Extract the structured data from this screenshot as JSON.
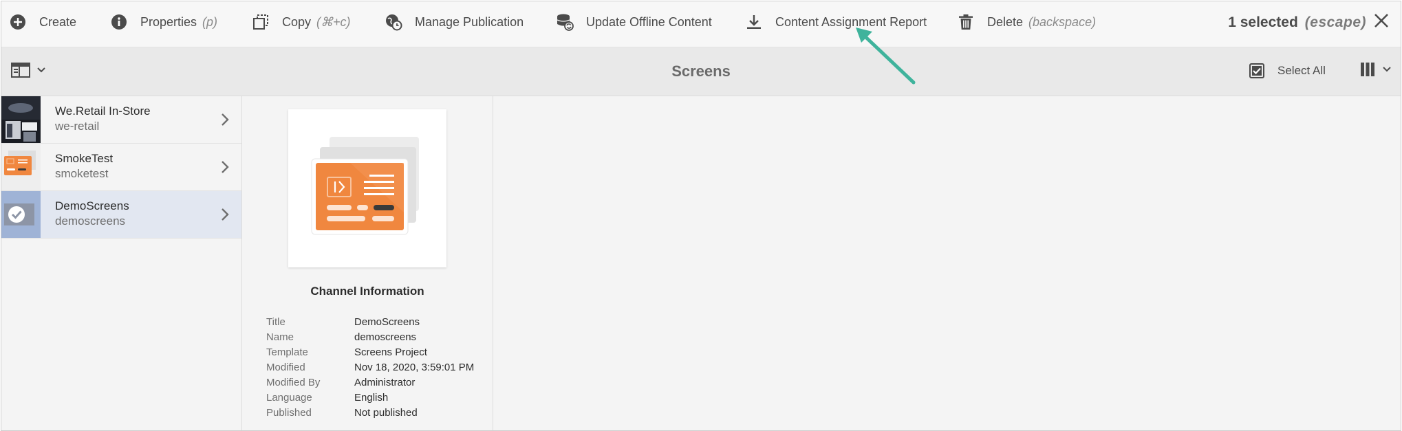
{
  "actionbar": {
    "items": [
      {
        "label": "Create",
        "icon": "plus-circle-icon"
      },
      {
        "label": "Properties",
        "shortcut": "(p)",
        "icon": "info-circle-icon"
      },
      {
        "label": "Copy",
        "shortcut": "(⌘+c)",
        "icon": "copy-icon"
      },
      {
        "label": "Manage Publication",
        "icon": "globe-clock-icon"
      },
      {
        "label": "Update Offline Content",
        "icon": "database-sync-icon"
      },
      {
        "label": "Content Assignment Report",
        "icon": "download-icon"
      },
      {
        "label": "Delete",
        "shortcut": "(backspace)",
        "icon": "trash-icon"
      }
    ],
    "selection": {
      "count_label": "1 selected",
      "escape_hint": "(escape)"
    }
  },
  "titlebar": {
    "title": "Screens",
    "select_all": "Select All"
  },
  "column_items": [
    {
      "title": "We.Retail In-Store",
      "name": "we-retail"
    },
    {
      "title": "SmokeTest",
      "name": "smoketest"
    },
    {
      "title": "DemoScreens",
      "name": "demoscreens",
      "selected": true
    }
  ],
  "preview": {
    "heading": "Channel Information",
    "fields": [
      {
        "key": "Title",
        "value": "DemoScreens"
      },
      {
        "key": "Name",
        "value": "demoscreens"
      },
      {
        "key": "Template",
        "value": "Screens Project"
      },
      {
        "key": "Modified",
        "value": "Nov 18, 2020, 3:59:01 PM"
      },
      {
        "key": "Modified By",
        "value": "Administrator"
      },
      {
        "key": "Language",
        "value": "English"
      },
      {
        "key": "Published",
        "value": "Not published"
      }
    ]
  },
  "colors": {
    "accent_orange": "#f0873f",
    "annotation_arrow": "#3fb39c",
    "selected_row": "#e2e7f1"
  }
}
